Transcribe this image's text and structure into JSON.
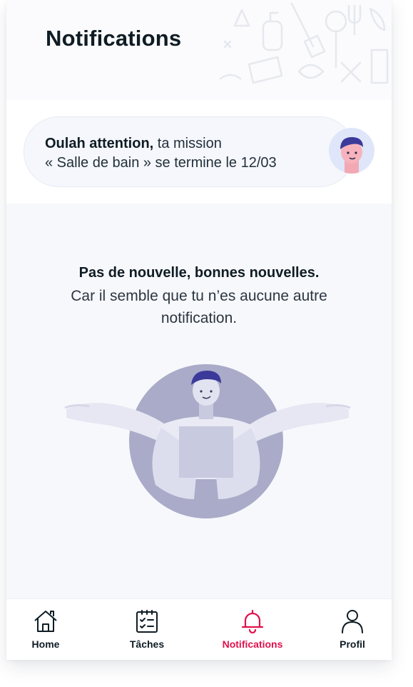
{
  "header": {
    "title": "Notifications"
  },
  "notification": {
    "bold_text": "Oulah attention,",
    "text_line1": "ta mission",
    "text_line2": "« Salle de bain » se termine le 12/03",
    "avatar_icon": "user-avatar-icon"
  },
  "empty_state": {
    "title": "Pas de nouvelle, bonnes nouvelles.",
    "body": "Car il semble que tu n’es aucune autre notification.",
    "illustration": "shrugging-person-illustration"
  },
  "tabbar": {
    "items": [
      {
        "label": "Home",
        "icon": "home-icon",
        "active": false
      },
      {
        "label": "Tâches",
        "icon": "checklist-icon",
        "active": false
      },
      {
        "label": "Notifications",
        "icon": "bell-icon",
        "active": true
      },
      {
        "label": "Profil",
        "icon": "user-icon",
        "active": false
      }
    ],
    "active_color": "#e0114c",
    "inactive_color": "#0f1c24"
  },
  "colors": {
    "card_background": "#f5f7fc",
    "empty_background": "#f7f8fc",
    "illustration_circle": "#a9abc8"
  }
}
